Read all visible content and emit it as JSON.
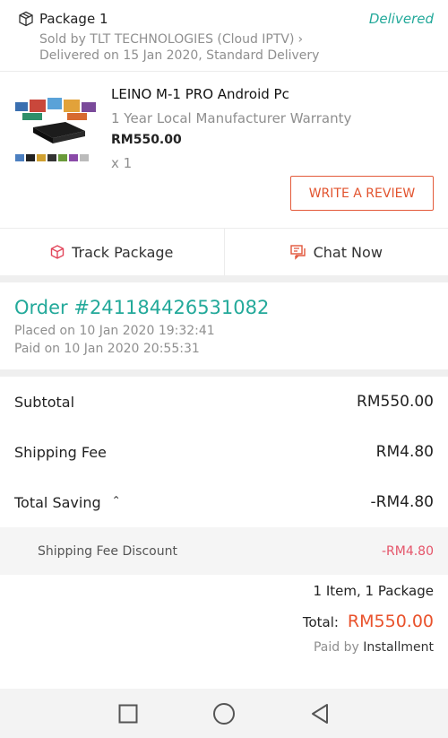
{
  "package": {
    "title": "Package 1",
    "status": "Delivered",
    "seller": "Sold by TLT TECHNOLOGIES (Cloud IPTV)",
    "delivery": "Delivered on 15 Jan 2020, Standard Delivery"
  },
  "product": {
    "name": "LEINO M-1 PRO Android Pc",
    "warranty": "1 Year Local Manufacturer Warranty",
    "price": "RM550.00",
    "quantity": "x 1",
    "review_label": "WRITE A REVIEW"
  },
  "actions": {
    "track_label": "Track Package",
    "chat_label": "Chat Now"
  },
  "order": {
    "number": "Order #241184426531082",
    "placed": "Placed on 10 Jan 2020  19:32:41",
    "paid": "Paid on 10 Jan 2020  20:55:31"
  },
  "summary": {
    "subtotal_label": "Subtotal",
    "subtotal_value": "RM550.00",
    "shipping_label": "Shipping Fee",
    "shipping_value": "RM4.80",
    "saving_label": "Total Saving",
    "saving_value": "-RM4.80",
    "discount_label": "Shipping Fee Discount",
    "discount_value": "-RM4.80"
  },
  "totals": {
    "items": "1 Item, 1 Package",
    "total_label": "Total:",
    "total_value": "RM550.00",
    "paid_by_label": "Paid by",
    "paid_by_method": "Installment"
  },
  "colors": {
    "accent_teal": "#23a99a",
    "accent_orange": "#e9522c",
    "discount_red": "#e5556a"
  }
}
